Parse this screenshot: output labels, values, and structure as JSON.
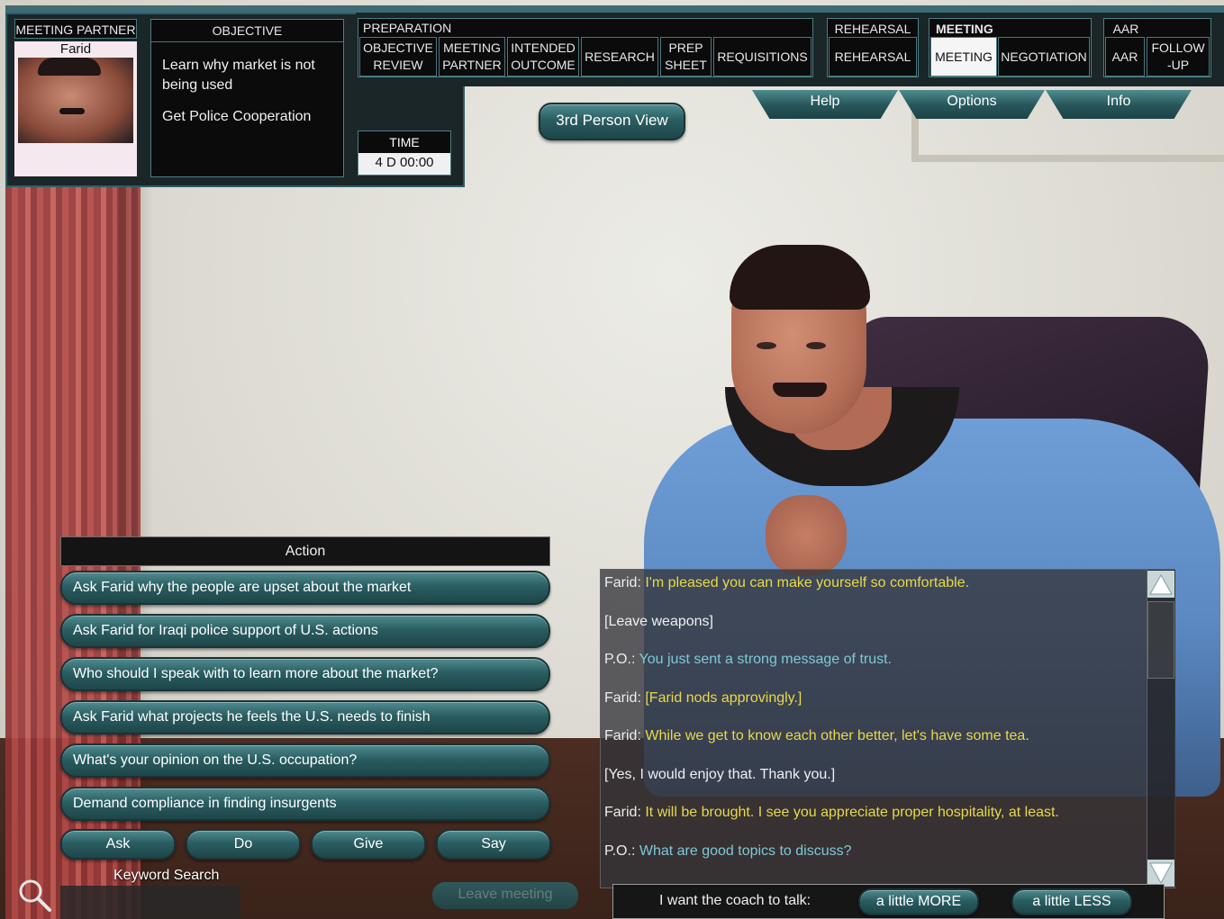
{
  "partner": {
    "title": "MEETING PARTNER",
    "name": "Farid"
  },
  "objective": {
    "title": "OBJECTIVE",
    "line1": "Learn why market is not",
    "line2": "being used",
    "line3": "Get Police Cooperation"
  },
  "time": {
    "title": "TIME",
    "value": "4 D 00:00"
  },
  "preparation": {
    "title": "PREPARATION",
    "objective_review_1": "OBJECTIVE",
    "objective_review_2": "REVIEW",
    "meeting_partner_1": "MEETING",
    "meeting_partner_2": "PARTNER",
    "intended_outcome_1": "INTENDED",
    "intended_outcome_2": "OUTCOME",
    "research": "RESEARCH",
    "prep_sheet_1": "PREP",
    "prep_sheet_2": "SHEET",
    "requisitions": "REQUISITIONS"
  },
  "rehearsal": {
    "title": "REHEARSAL",
    "item": "REHEARSAL"
  },
  "meeting": {
    "title": "MEETING",
    "meeting": "MEETING",
    "negotiation": "NEGOTIATION"
  },
  "aar": {
    "title": "AAR",
    "aar": "AAR",
    "followup_1": "FOLLOW",
    "followup_2": "-UP"
  },
  "view_button": "3rd Person View",
  "top_tabs": {
    "help": "Help",
    "options": "Options",
    "info": "Info"
  },
  "action": {
    "title": "Action",
    "items": [
      "Ask Farid why the people are upset about the market",
      "Ask Farid for Iraqi police support of U.S. actions",
      "Who should I speak with to learn more about the market?",
      "Ask Farid what projects he feels the U.S. needs to finish",
      "What's your opinion on the U.S. occupation?",
      "Demand compliance in finding insurgents"
    ],
    "verbs": [
      "Ask",
      "Do",
      "Give",
      "Say"
    ]
  },
  "search": {
    "label": "Keyword Search"
  },
  "leave_meeting": "Leave meeting",
  "log": [
    {
      "speaker": "Farid:",
      "text": "I'm pleased you can make yourself so comfortable.",
      "type": "farid"
    },
    {
      "speaker": "",
      "text": "[Leave weapons]",
      "type": "plain"
    },
    {
      "speaker": "P.O.:",
      "text": "You just sent a strong message of trust.",
      "type": "po"
    },
    {
      "speaker": "Farid:",
      "text": "[Farid nods approvingly.]",
      "type": "farid"
    },
    {
      "speaker": "Farid:",
      "text": "While we get to know each other better, let's have some tea.",
      "type": "farid"
    },
    {
      "speaker": "",
      "text": "[Yes, I would enjoy that. Thank you.]",
      "type": "plain"
    },
    {
      "speaker": "Farid:",
      "text": "It will be brought. I see you appreciate proper hospitality, at least.",
      "type": "farid"
    },
    {
      "speaker": "P.O.:",
      "text": "What are good topics to discuss?",
      "type": "po"
    }
  ],
  "coach": {
    "label": "I want the coach to talk:",
    "more": "a little MORE",
    "less": "a little LESS"
  },
  "colors": {
    "accent_teal": "#2a5d61",
    "farid_text": "#e9d84a",
    "po_text": "#7fc8d8"
  },
  "icons": {
    "scroll_up": "triangle-up-icon",
    "scroll_down": "triangle-down-icon",
    "search": "magnifier-icon"
  }
}
